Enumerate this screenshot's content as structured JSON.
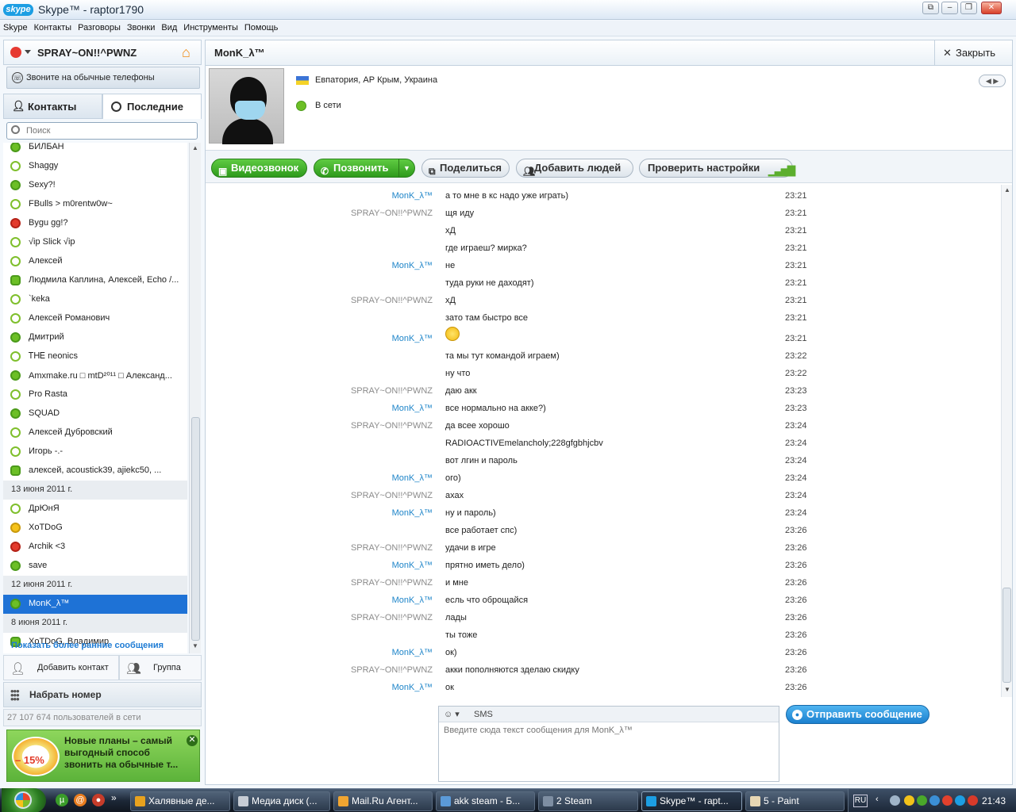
{
  "window": {
    "title": "Skype™ - raptor1790",
    "logo": "skype"
  },
  "menu": [
    "Skype",
    "Контакты",
    "Разговоры",
    "Звонки",
    "Вид",
    "Инструменты",
    "Помощь"
  ],
  "profile": {
    "name": "SPRAY~ON!!^PWNZ",
    "call_phones": "Звоните на обычные телефоны"
  },
  "tabs": {
    "contacts": "Контакты",
    "recent": "Последние"
  },
  "search": {
    "placeholder": "Поиск"
  },
  "contacts": [
    {
      "name": "БИЛБАН",
      "status": "online"
    },
    {
      "name": "Shaggy",
      "status": "offline"
    },
    {
      "name": "Sexy?!",
      "status": "online"
    },
    {
      "name": "FBulls > m0rentw0w~",
      "status": "offline"
    },
    {
      "name": "Bygu gg!?",
      "status": "busy"
    },
    {
      "name": "√ip Slick √ip",
      "status": "offline"
    },
    {
      "name": "Алексей",
      "status": "offline"
    },
    {
      "name": "Людмила Каплина, Алексей, Echo /...",
      "status": "group"
    },
    {
      "name": "`keka",
      "status": "offline"
    },
    {
      "name": "Алексей Романович",
      "status": "offline"
    },
    {
      "name": "Дмитрий",
      "status": "online"
    },
    {
      "name": "ᎢᎻᎬ neonics",
      "status": "offline"
    },
    {
      "name": "Amxmake.ru □ mtD²⁰¹¹ □ Александ...",
      "status": "online"
    },
    {
      "name": "Pro Rasta",
      "status": "offline"
    },
    {
      "name": "SQUAD",
      "status": "online"
    },
    {
      "name": "Алексей Дубровский",
      "status": "offline"
    },
    {
      "name": "Игорь                    -.-",
      "status": "offline"
    },
    {
      "name": "алексей, acoustick39, ajiekc50, ...",
      "status": "group"
    },
    {
      "name": "13 июня 2011 г.",
      "status": "header"
    },
    {
      "name": "ДрЮнЯ",
      "status": "offline"
    },
    {
      "name": "XoTDoG",
      "status": "away"
    },
    {
      "name": "Archik <3",
      "status": "busy"
    },
    {
      "name": "save",
      "status": "online"
    },
    {
      "name": "12 июня 2011 г.",
      "status": "header"
    },
    {
      "name": "MonK_λ™",
      "status": "selected"
    },
    {
      "name": "8 июня 2011 г.",
      "status": "header"
    },
    {
      "name": "XoTDoG, Владимир",
      "status": "group"
    }
  ],
  "show_more": "Показать более ранние сообщения",
  "bottom": {
    "add_contact": "Добавить контакт",
    "group": "Группа",
    "dial": "Набрать номер",
    "online_count": "27 107 674 пользователей в сети"
  },
  "promo": {
    "discount": "– 15%",
    "text": "Новые планы – самый выгодный способ звонить на обычные т..."
  },
  "chat": {
    "name": "MonK_λ™",
    "close": "Закрыть",
    "location": "Евпатория, АР Крым, Украина",
    "status": "В сети",
    "buttons": {
      "video": "Видеозвонок",
      "call": "Позвонить",
      "share": "Поделиться",
      "add_people": "Добавить людей",
      "check_settings": "Проверить настройки"
    },
    "messages": [
      {
        "author": "MonK_λ™",
        "self": false,
        "text": "а то мне в кс надо уже играть)",
        "time": "23:21"
      },
      {
        "author": "SPRAY~ON!!^PWNZ",
        "self": true,
        "text": "щя  иду",
        "time": "23:21"
      },
      {
        "author": "",
        "self": true,
        "text": "хД",
        "time": "23:21"
      },
      {
        "author": "",
        "self": true,
        "text": "где играеш? мирка?",
        "time": "23:21"
      },
      {
        "author": "MonK_λ™",
        "self": false,
        "text": "не",
        "time": "23:21"
      },
      {
        "author": "",
        "self": false,
        "text": "туда руки не даходят)",
        "time": "23:21"
      },
      {
        "author": "SPRAY~ON!!^PWNZ",
        "self": true,
        "text": "хД",
        "time": "23:21"
      },
      {
        "author": "",
        "self": true,
        "text": "зато там быстро все",
        "time": "23:21"
      },
      {
        "author": "MonK_λ™",
        "self": false,
        "text": "",
        "emoticon": "smile",
        "time": "23:21"
      },
      {
        "author": "",
        "self": false,
        "text": "та мы тут командой играем)",
        "time": "23:22"
      },
      {
        "author": "",
        "self": false,
        "text": "ну что",
        "time": "23:22"
      },
      {
        "author": "SPRAY~ON!!^PWNZ",
        "self": true,
        "text": "даю акк",
        "time": "23:23"
      },
      {
        "author": "MonK_λ™",
        "self": false,
        "text": "все нормально на акке?)",
        "time": "23:23"
      },
      {
        "author": "SPRAY~ON!!^PWNZ",
        "self": true,
        "text": "да всее хорошо",
        "time": "23:24"
      },
      {
        "author": "",
        "self": true,
        "text": "RADIOACTIVEmelancholy;228gfgbhjcbv",
        "time": "23:24"
      },
      {
        "author": "",
        "self": true,
        "text": "вот лгин и пароль",
        "time": "23:24"
      },
      {
        "author": "MonK_λ™",
        "self": false,
        "text": "ого)",
        "time": "23:24"
      },
      {
        "author": "SPRAY~ON!!^PWNZ",
        "self": true,
        "text": "ахах",
        "time": "23:24"
      },
      {
        "author": "MonK_λ™",
        "self": false,
        "text": "ну и пароль)",
        "time": "23:24"
      },
      {
        "author": "",
        "self": false,
        "text": "все работает спс)",
        "time": "23:26"
      },
      {
        "author": "SPRAY~ON!!^PWNZ",
        "self": true,
        "text": "удачи в игре",
        "time": "23:26"
      },
      {
        "author": "MonK_λ™",
        "self": false,
        "text": "прятно иметь дело)",
        "time": "23:26"
      },
      {
        "author": "SPRAY~ON!!^PWNZ",
        "self": true,
        "text": "и мне",
        "time": "23:26"
      },
      {
        "author": "MonK_λ™",
        "self": false,
        "text": "есль что оброщайся",
        "time": "23:26"
      },
      {
        "author": "SPRAY~ON!!^PWNZ",
        "self": true,
        "text": "лады",
        "time": "23:26"
      },
      {
        "author": "",
        "self": true,
        "text": "ты тоже",
        "time": "23:26"
      },
      {
        "author": "MonK_λ™",
        "self": false,
        "text": "ок)",
        "time": "23:26"
      },
      {
        "author": "SPRAY~ON!!^PWNZ",
        "self": true,
        "text": "акки пополняются зделаю скидку",
        "time": "23:26"
      },
      {
        "author": "MonK_λ™",
        "self": false,
        "text": "ок",
        "time": "23:26"
      }
    ],
    "compose": {
      "sms": "SMS",
      "placeholder": "Введите сюда текст сообщения для MonK_λ™",
      "send": "Отправить сообщение"
    }
  },
  "taskbar": {
    "tasks": [
      "Халявные де...",
      "Медиа диск (...",
      "Mail.Ru Агент...",
      "akk steam - Б...",
      "2 Steam",
      "Skype™ - rapt...",
      "5 - Paint"
    ],
    "active_task": "Skype™ - rapt...",
    "lang": "RU",
    "clock": "21:43"
  }
}
